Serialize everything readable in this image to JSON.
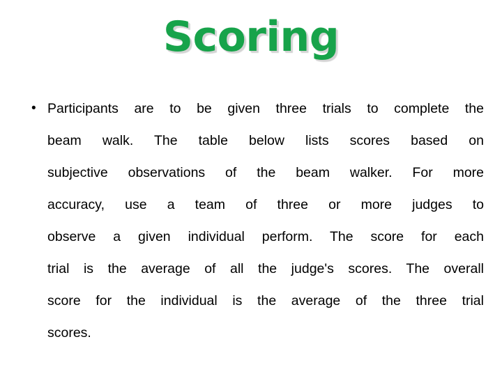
{
  "slide": {
    "background_color": "#ffffff",
    "title": {
      "text": "Scoring",
      "color": "#17a34a",
      "shadow_color": "#d4d4d4"
    },
    "body": {
      "bullet_glyph": "•",
      "text_color": "#000000",
      "items": [
        {
          "full_text": "Participants are to be given three trials to complete the beam walk. The table below lists scores based on subjective observations of the beam walker. For more accuracy, use a team of three or more judges to observe a given individual perform. The score for each trial is the average of all the judge's scores. The overall score for the individual is the average of the three trial scores.",
          "lines": [
            "Participants are to be given three trials to complete the",
            "beam walk. The table below lists scores based on",
            "subjective observations of the beam walker. For more",
            "accuracy, use a team of three or more judges to",
            "observe a given individual perform. The score for each",
            "trial is the average of all the judge's scores. The overall",
            "score for the individual is the average of the three trial",
            "scores."
          ]
        }
      ]
    }
  }
}
